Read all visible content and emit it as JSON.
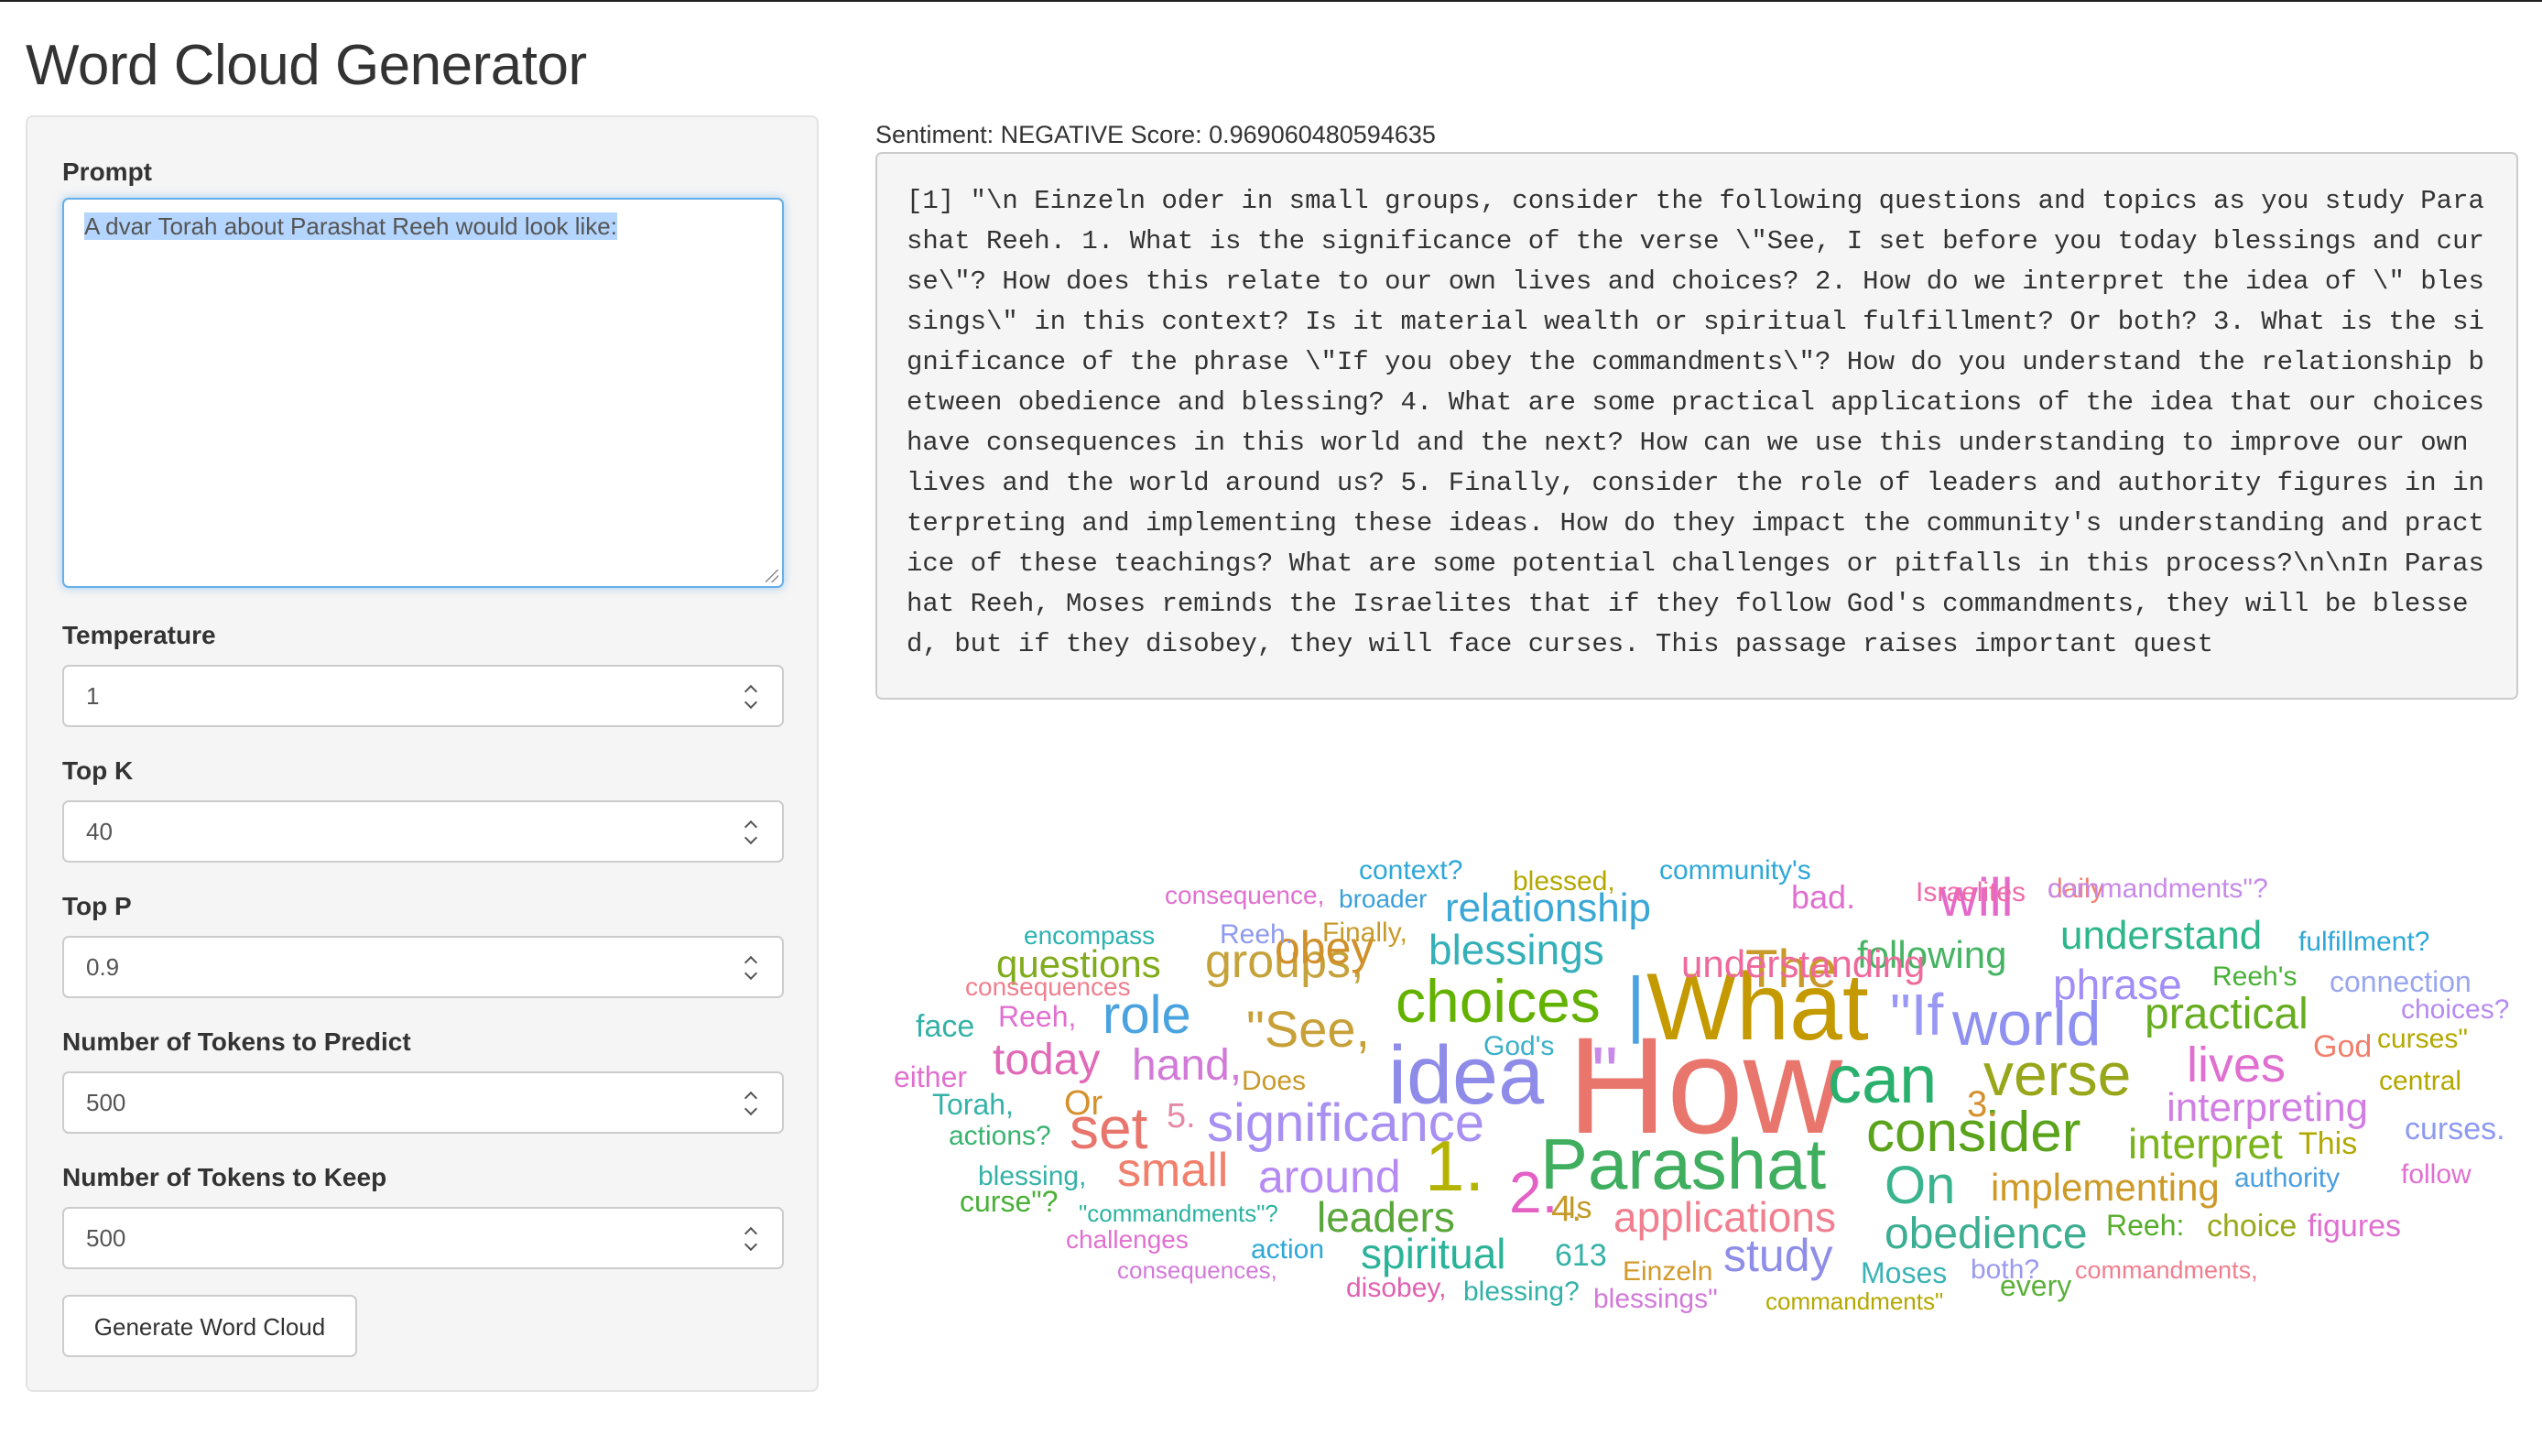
{
  "app": {
    "title": "Word Cloud Generator"
  },
  "sidebar": {
    "prompt_label": "Prompt",
    "prompt_value": "A dvar Torah about Parashat Reeh would look like:",
    "temperature_label": "Temperature",
    "temperature_value": "1",
    "topk_label": "Top K",
    "topk_value": "40",
    "topp_label": "Top P",
    "topp_value": "0.9",
    "ntokens_label": "Number of Tokens to Predict",
    "ntokens_value": "500",
    "nkeep_label": "Number of Tokens to Keep",
    "nkeep_value": "500",
    "generate_label": "Generate Word Cloud"
  },
  "output": {
    "sentiment": "Sentiment: NEGATIVE Score: 0.969060480594635",
    "text": "[1] \"\\n Einzeln oder in small groups, consider the following questions and topics as you study Parashat Reeh. 1. What is the significance of the verse \\\"See, I set before you today blessings and curse\\\"? How does this relate to our own lives and choices? 2. How do we interpret the idea of \\\" blessings\\\" in this context? Is it material wealth or spiritual fulfillment? Or both? 3. What is the significance of the phrase \\\"If you obey the commandments\\\"? How do you understand the relationship between obedience and blessing? 4. What are some practical applications of the idea that our choices have consequences in this world and the next? How can we use this understanding to improve our own lives and the world around us? 5. Finally, consider the role of leaders and authority figures in interpreting and implementing these ideas. How do they impact the community's understanding and practice of these teachings? What are some potential challenges or pitfalls in this process?\\n\\nIn Parashat Reeh, Moses reminds the Israelites that if they follow God's commandments, they will be blessed, but if they disobey, they will face curses. This passage raises important quest"
  },
  "wordcloud": [
    {
      "text": "How",
      "color": "#e8766d"
    },
    {
      "text": "What",
      "color": "#c49a00"
    },
    {
      "text": "idea",
      "color": "#8e8ce8"
    },
    {
      "text": "Parashat",
      "color": "#3fae5e"
    },
    {
      "text": "choices",
      "color": "#64b200"
    },
    {
      "text": "can",
      "color": "#2ab06d"
    },
    {
      "text": "consider",
      "color": "#5aa31b"
    },
    {
      "text": "world",
      "color": "#8f91f0"
    },
    {
      "text": "verse",
      "color": "#98a61a"
    },
    {
      "text": "significance",
      "color": "#a88ff2"
    },
    {
      "text": "1.",
      "color": "#b4b300"
    },
    {
      "text": "2.",
      "color": "#e460c5"
    },
    {
      "text": "\"If",
      "color": "#9a98f5"
    },
    {
      "text": "The",
      "color": "#c99a28"
    },
    {
      "text": "\"See,",
      "color": "#c8a038"
    },
    {
      "text": "role",
      "color": "#4aa3df"
    },
    {
      "text": "set",
      "color": "#e8766d"
    },
    {
      "text": "small",
      "color": "#f07f6c"
    },
    {
      "text": "lives",
      "color": "#e070d0"
    },
    {
      "text": "On",
      "color": "#3ab48e"
    },
    {
      "text": "will",
      "color": "#e36ac9"
    },
    {
      "text": "obedience",
      "color": "#3dae92"
    },
    {
      "text": "interpret",
      "color": "#7ab31a"
    },
    {
      "text": "practical",
      "color": "#67ad20"
    },
    {
      "text": "groups,",
      "color": "#c6a23a"
    },
    {
      "text": "blessings",
      "color": "#33b0b8"
    },
    {
      "text": "relationship",
      "color": "#3ba7d5"
    },
    {
      "text": "obey",
      "color": "#d0902a"
    },
    {
      "text": "today",
      "color": "#e06ab8"
    },
    {
      "text": "hand,",
      "color": "#d27ad8"
    },
    {
      "text": "around",
      "color": "#b68af2"
    },
    {
      "text": "leaders",
      "color": "#59a63a"
    },
    {
      "text": "spiritual",
      "color": "#2bb39a"
    },
    {
      "text": "study",
      "color": "#8e8ee8"
    },
    {
      "text": "applications",
      "color": "#f07f8f"
    },
    {
      "text": "implementing",
      "color": "#cd9a28"
    },
    {
      "text": "interpreting",
      "color": "#d07ee3"
    },
    {
      "text": "understand",
      "color": "#2db58b"
    },
    {
      "text": "phrase",
      "color": "#a28ef5"
    },
    {
      "text": "following",
      "color": "#46b464"
    },
    {
      "text": "questions",
      "color": "#80ac1c"
    },
    {
      "text": "understanding",
      "color": "#ee6a9c"
    },
    {
      "text": "3.",
      "color": "#d4902a"
    },
    {
      "text": "4.",
      "color": "#c79a2a"
    },
    {
      "text": "5.",
      "color": "#e58aa5"
    },
    {
      "text": "Is",
      "color": "#c09a26"
    },
    {
      "text": "613",
      "color": "#35b2a8"
    },
    {
      "text": "Einzeln",
      "color": "#d19a2a"
    },
    {
      "text": "Moses",
      "color": "#3bb3b7"
    },
    {
      "text": "both?",
      "color": "#9a9af0"
    },
    {
      "text": "commandments,",
      "color": "#f07f8f"
    },
    {
      "text": "every",
      "color": "#5bb03a"
    },
    {
      "text": "Reeh:",
      "color": "#57ad2b"
    },
    {
      "text": "choice",
      "color": "#9aa81a"
    },
    {
      "text": "figures",
      "color": "#e070d0"
    },
    {
      "text": "authority",
      "color": "#4a9fdf"
    },
    {
      "text": "follow",
      "color": "#e070d0"
    },
    {
      "text": "This",
      "color": "#b3a800"
    },
    {
      "text": "curses.",
      "color": "#8e9af0"
    },
    {
      "text": "central",
      "color": "#b3a800"
    },
    {
      "text": "curses\"",
      "color": "#b3a800"
    },
    {
      "text": "God",
      "color": "#f07f6c"
    },
    {
      "text": "choices?",
      "color": "#b68af2"
    },
    {
      "text": "connection",
      "color": "#9aa6f0"
    },
    {
      "text": "Reeh's",
      "color": "#4ab038"
    },
    {
      "text": "fulfillment?",
      "color": "#2ea8d8"
    },
    {
      "text": "daily",
      "color": "#f07f6c"
    },
    {
      "text": "commandments\"?",
      "color": "#c88ae8"
    },
    {
      "text": "Israelites",
      "color": "#ee6aa8"
    },
    {
      "text": "bad.",
      "color": "#e070d0"
    },
    {
      "text": "community's",
      "color": "#2ea8d8"
    },
    {
      "text": "blessed,",
      "color": "#b3a800"
    },
    {
      "text": "context?",
      "color": "#2ea8d8"
    },
    {
      "text": "broader",
      "color": "#3aa0d8"
    },
    {
      "text": "consequence,",
      "color": "#e070d0"
    },
    {
      "text": "Finally,",
      "color": "#c89a2a"
    },
    {
      "text": "Reeh.",
      "color": "#8e9af0"
    },
    {
      "text": "encompass",
      "color": "#2bb3b0"
    },
    {
      "text": "consequences",
      "color": "#f07f8f"
    },
    {
      "text": "face",
      "color": "#35b2a8"
    },
    {
      "text": "Reeh,",
      "color": "#e070d0"
    },
    {
      "text": "either",
      "color": "#e070d0"
    },
    {
      "text": "God's",
      "color": "#3ab0c8"
    },
    {
      "text": "Does",
      "color": "#c89a2a"
    },
    {
      "text": "Or",
      "color": "#d4902a"
    },
    {
      "text": "Torah,",
      "color": "#35b2a8"
    },
    {
      "text": "actions?",
      "color": "#3ab370"
    },
    {
      "text": "blessing,",
      "color": "#35b2a8"
    },
    {
      "text": "curse\"?",
      "color": "#4ab038"
    },
    {
      "text": "\"commandments\"?",
      "color": "#2bb3a0"
    },
    {
      "text": "challenges",
      "color": "#e070d0"
    },
    {
      "text": "action",
      "color": "#2ea8d8"
    },
    {
      "text": "consequences,",
      "color": "#d27ad8"
    },
    {
      "text": "disobey,",
      "color": "#e060b0"
    },
    {
      "text": "blessing?",
      "color": "#35b2a8"
    },
    {
      "text": "blessings\"",
      "color": "#d27ad8"
    },
    {
      "text": "commandments\"",
      "color": "#b3a800"
    },
    {
      "text": "|",
      "color": "#4aa3df"
    },
    {
      "text": "\"",
      "color": "#c88ae8"
    }
  ]
}
